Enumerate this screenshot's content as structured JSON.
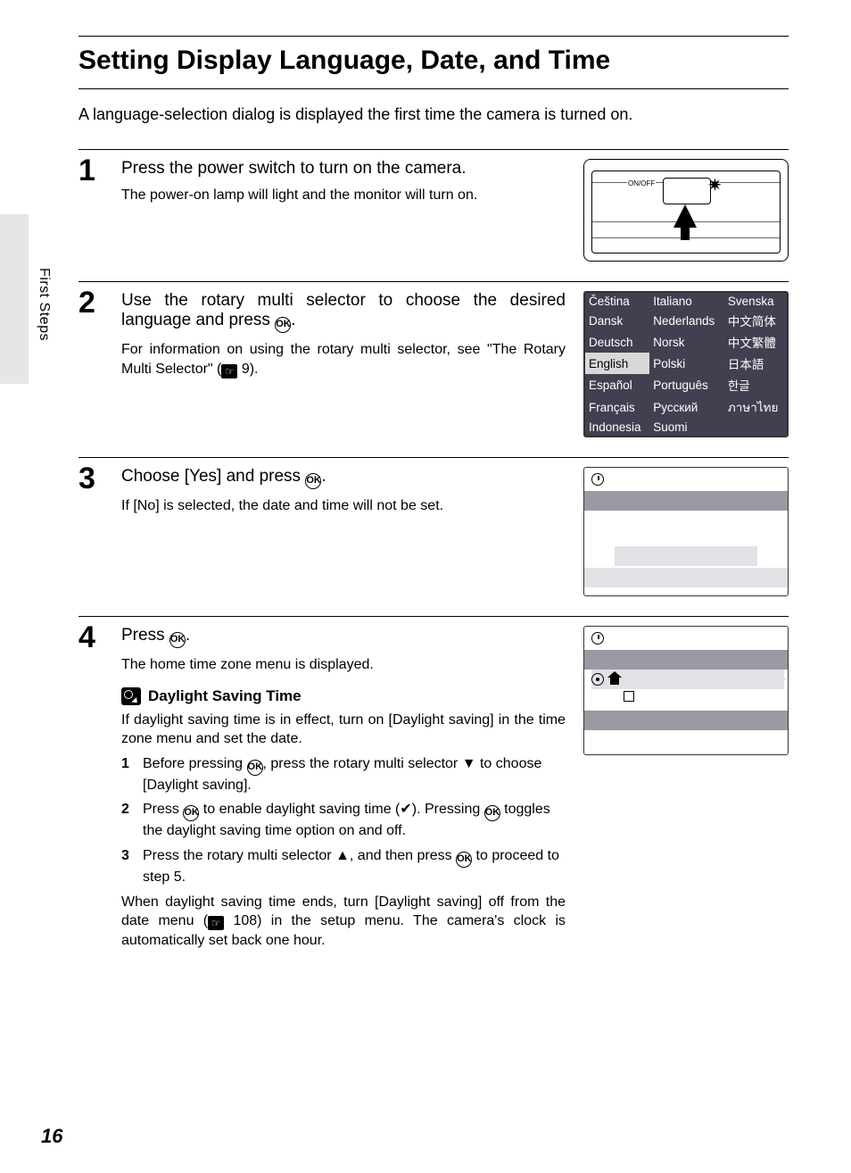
{
  "page_number": "16",
  "side_tab": "First Steps",
  "title": "Setting Display Language, Date, and Time",
  "intro": "A language-selection dialog is displayed the first time the camera is turned on.",
  "ok_glyph": "OK",
  "ref_glyph": "☞",
  "camera_label": "ON/OFF",
  "step1": {
    "num": "1",
    "title": "Press the power switch to turn on the camera.",
    "desc": "The power-on lamp will light and the monitor will turn on."
  },
  "step2": {
    "num": "2",
    "title_a": "Use the rotary multi selector to choose the desired language and press ",
    "title_b": ".",
    "desc_a": "For information on using the rotary multi selector, see \"The Rotary Multi Selector\" (",
    "desc_b": " 9).",
    "languages": {
      "col1": [
        "Čeština",
        "Dansk",
        "Deutsch",
        "English",
        "Español",
        "Français",
        "Indonesia"
      ],
      "col2": [
        "Italiano",
        "Nederlands",
        "Norsk",
        "Polski",
        "Português",
        "Русский",
        "Suomi"
      ],
      "col3": [
        "Svenska",
        "中文简体",
        "中文繁體",
        "日本語",
        "한글",
        "ภาษาไทย",
        ""
      ],
      "selected": "English"
    }
  },
  "step3": {
    "num": "3",
    "title_a": "Choose [Yes] and press ",
    "title_b": ".",
    "desc": "If [No] is selected, the date and time will not be set."
  },
  "step4": {
    "num": "4",
    "title_a": "Press ",
    "title_b": ".",
    "desc": "The home time zone menu is displayed.",
    "dst": {
      "heading": "Daylight Saving Time",
      "intro": "If daylight saving time is in effect, turn on [Daylight saving] in the time zone menu and set the date.",
      "s1_a": "Before pressing ",
      "s1_b": ", press the rotary multi selector ▼ to choose [Daylight saving].",
      "s2_a": "Press ",
      "s2_b": " to enable daylight saving time (✔). Pressing ",
      "s2_c": " toggles the daylight saving time option on and off.",
      "s3_a": "Press the rotary multi selector ▲, and then press ",
      "s3_b": " to proceed to step 5.",
      "outro_a": "When daylight saving time ends, turn [Daylight saving] off from the date menu (",
      "outro_b": " 108) in the setup menu. The camera's clock is automatically set back one hour."
    }
  }
}
